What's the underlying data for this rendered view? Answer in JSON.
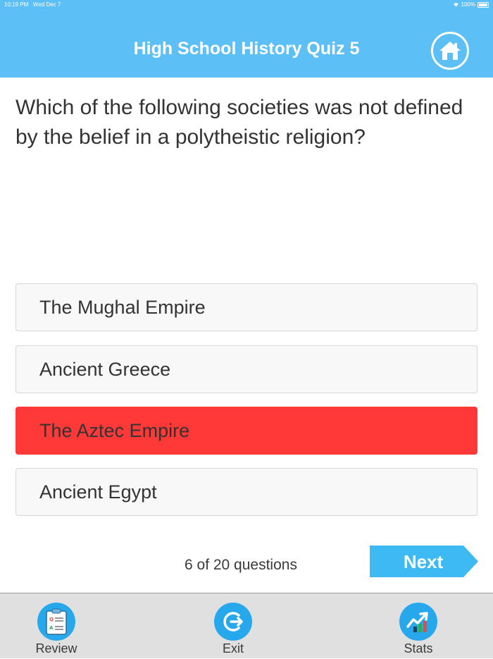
{
  "status_bar": {
    "time": "10:19 PM",
    "date": "Wed Dec 7",
    "battery": "100%"
  },
  "header": {
    "title": "High School History Quiz 5",
    "home_icon": "home-icon"
  },
  "question": {
    "text": "Which of the following societies was not defined by the belief in a polytheistic religion?"
  },
  "answers": [
    {
      "label": "The Mughal Empire",
      "selected": false
    },
    {
      "label": "Ancient Greece",
      "selected": false
    },
    {
      "label": "The Aztec Empire",
      "selected": true
    },
    {
      "label": "Ancient Egypt",
      "selected": false
    }
  ],
  "progress": {
    "text": "6 of 20 questions",
    "current": 6,
    "total": 20
  },
  "next_button": {
    "label": "Next"
  },
  "tabs": [
    {
      "label": "Review",
      "icon": "clipboard-icon"
    },
    {
      "label": "Exit",
      "icon": "exit-icon"
    },
    {
      "label": "Stats",
      "icon": "chart-up-icon"
    }
  ],
  "colors": {
    "header": "#5cbff5",
    "selected_answer": "#ff3838",
    "tab_icon": "#27a7ec",
    "tab_bar": "#e0e0e0"
  }
}
